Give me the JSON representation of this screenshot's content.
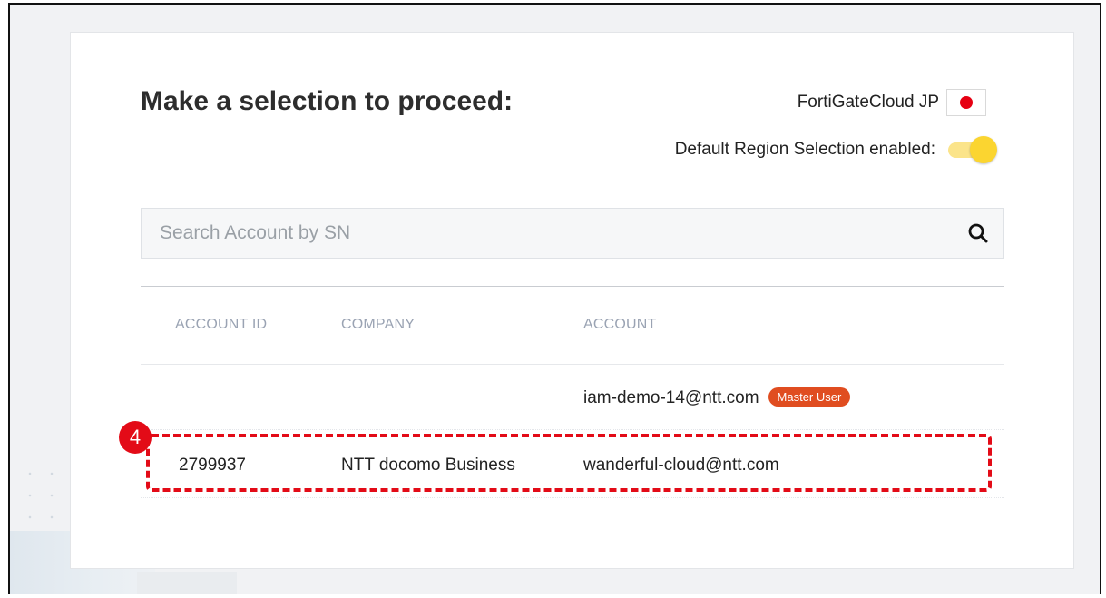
{
  "page": {
    "title": "Make a selection to proceed:"
  },
  "region": {
    "label": "FortiGateCloud JP",
    "flag_color": "#e60012",
    "default_selection_label": "Default Region Selection enabled:",
    "default_selection_enabled": true
  },
  "search": {
    "placeholder": "Search Account by SN",
    "value": "",
    "icon": "search-icon"
  },
  "table": {
    "columns": [
      "ACCOUNT ID",
      "COMPANY",
      "ACCOUNT"
    ],
    "rows": [
      {
        "account_id": "",
        "company": "",
        "account": "iam-demo-14@ntt.com",
        "badge": "Master User"
      },
      {
        "account_id": "2799937",
        "company": "NTT docomo Business",
        "account": "wanderful-cloud@ntt.com",
        "badge": ""
      }
    ]
  },
  "annotation": {
    "step_number": "4",
    "color": "#e30b17"
  },
  "colors": {
    "badge": "#e04d20",
    "toggle": "#fbd530"
  }
}
